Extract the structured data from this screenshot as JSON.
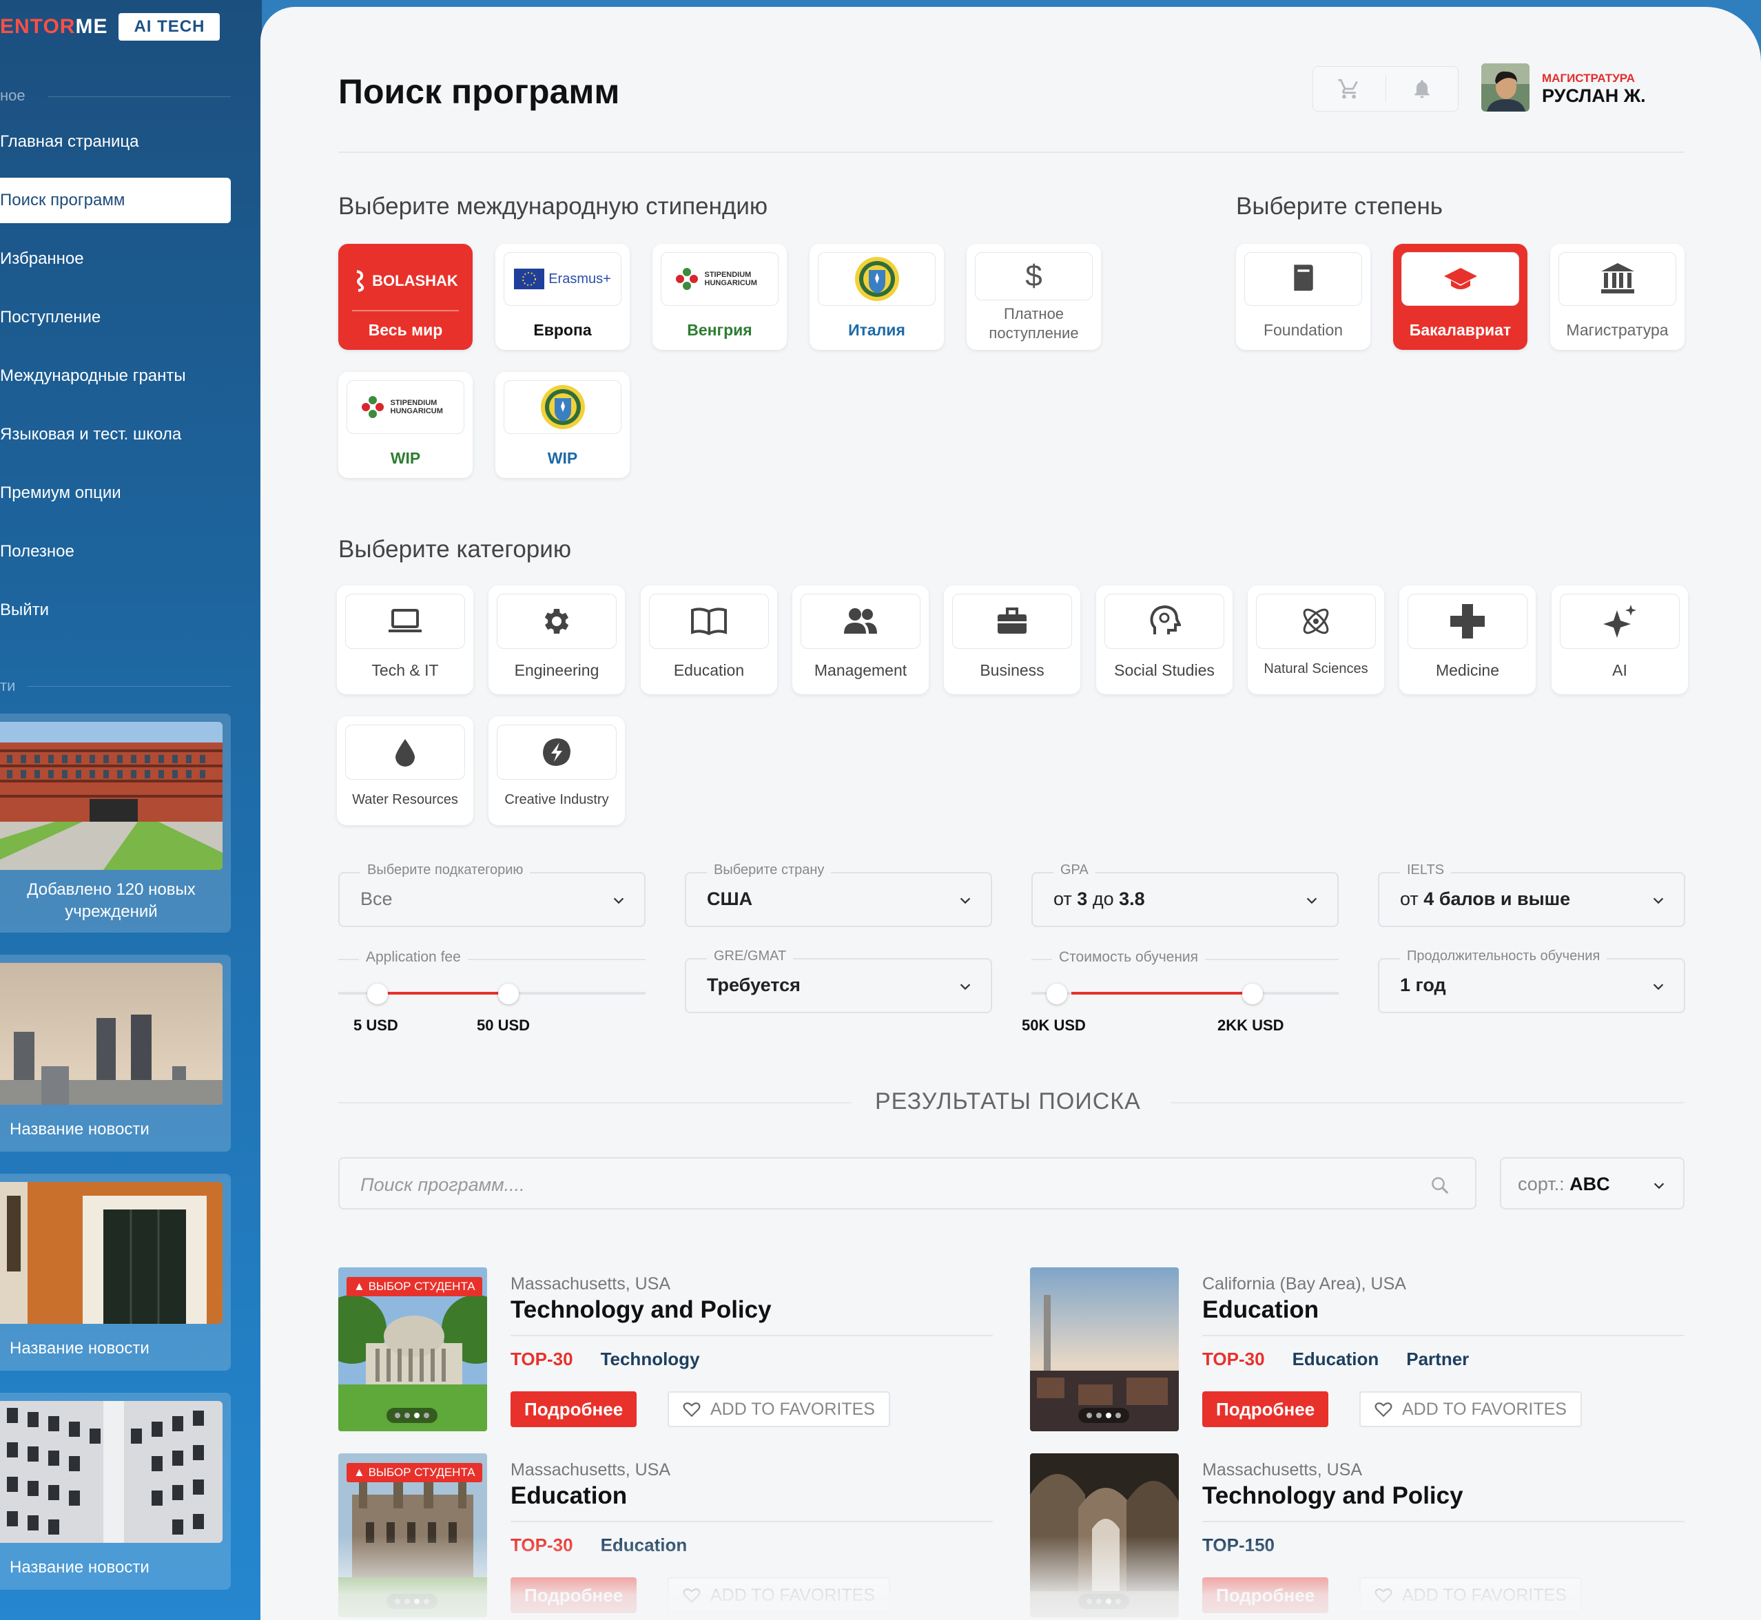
{
  "brand": {
    "logo_red": "ENTOR",
    "logo_white": "ME",
    "badge": "AI TECH",
    "accent": "#e8312b"
  },
  "sidebar": {
    "section_main": "ное",
    "items": [
      {
        "label": "Главная страница"
      },
      {
        "label": "Поиск программ"
      },
      {
        "label": "Избранное"
      },
      {
        "label": "Поступление"
      },
      {
        "label": "Международные гранты"
      },
      {
        "label": "Языковая и тест. школа"
      },
      {
        "label": "Премиум опции"
      },
      {
        "label": "Полезное"
      },
      {
        "label": "Выйти"
      }
    ],
    "section_news": "ти",
    "news": [
      {
        "caption": "Добавлено 120 новых учреждений"
      },
      {
        "caption": "Название новости"
      },
      {
        "caption": "Название новости"
      },
      {
        "caption": "Название новости"
      }
    ]
  },
  "header": {
    "title": "Поиск программ",
    "cart_icon": "cart-icon",
    "bell_icon": "bell-icon",
    "user_role": "МАГИСТРАТУРА",
    "user_name": "РУСЛАН Ж."
  },
  "scholarship": {
    "title": "Выберите международную стипендию",
    "items": [
      {
        "logo": "BOLASHAK",
        "label": "Весь мир",
        "selected": true
      },
      {
        "logo": "Erasmus+",
        "label": "Европа"
      },
      {
        "logo": "STIPENDIUM HUNGARICUM",
        "label": "Венгрия"
      },
      {
        "logo": "emblem",
        "label": "Италия"
      },
      {
        "logo": "$",
        "label": "Платное поступление"
      },
      {
        "logo": "STIPENDIUM HUNGARICUM",
        "label": "WIP"
      },
      {
        "logo": "emblem",
        "label": "WIP"
      }
    ]
  },
  "degree": {
    "title": "Выберите степень",
    "items": [
      {
        "label": "Foundation",
        "icon": "book-icon"
      },
      {
        "label": "Бакалавриат",
        "icon": "graduation-cap-icon",
        "selected": true
      },
      {
        "label": "Магистратура",
        "icon": "institution-icon"
      }
    ]
  },
  "category": {
    "title": "Выберите категорию",
    "items": [
      {
        "label": "Tech & IT",
        "icon": "laptop-icon"
      },
      {
        "label": "Engineering",
        "icon": "gear-icon"
      },
      {
        "label": "Education",
        "icon": "book-open-icon"
      },
      {
        "label": "Management",
        "icon": "users-icon"
      },
      {
        "label": "Business",
        "icon": "briefcase-icon"
      },
      {
        "label": "Social Studies",
        "icon": "head-icon"
      },
      {
        "label": "Natural Sciences",
        "icon": "atom-icon"
      },
      {
        "label": "Medicine",
        "icon": "cross-icon"
      },
      {
        "label": "AI",
        "icon": "sparkle-icon"
      },
      {
        "label": "Water Resources",
        "icon": "drop-icon"
      },
      {
        "label": "Creative Industry",
        "icon": "creative-icon"
      }
    ]
  },
  "filters": {
    "subcategory": {
      "legend": "Выберите подкатегорию",
      "value": "Все"
    },
    "country": {
      "legend": "Выберите страну",
      "value": "США"
    },
    "gpa": {
      "legend": "GPA",
      "value_from": "от ",
      "value_a": "3",
      "value_mid": " до ",
      "value_b": "3.8"
    },
    "ielts": {
      "legend": "IELTS",
      "value_from": "от ",
      "value_bold": "4 балов и выше"
    },
    "app_fee": {
      "legend": "Application fee",
      "min_label": "5 USD",
      "max_label": "50 USD",
      "min_value": 5,
      "max_value": 50
    },
    "gre": {
      "legend": "GRE/GMAT",
      "value": "Требуется"
    },
    "tuition": {
      "legend": "Стоимость обучения",
      "min_label": "50K USD",
      "max_label": "2KK USD"
    },
    "duration": {
      "legend": "Продолжительность обучения",
      "value": "1 год"
    }
  },
  "results": {
    "title": "РЕЗУЛЬТАТЫ ПОИСКА",
    "search_placeholder": "Поиск программ....",
    "sort_label": "сорт.: ",
    "sort_value": "ABC",
    "more_label": "Подробнее",
    "fav_label": "ADD TO FAVORITES",
    "badge_label": "ВЫБОР СТУДЕНТА",
    "items": [
      {
        "location": "Massachusetts, USA",
        "title": "Technology and Policy",
        "rank": "TOP-30",
        "tags": [
          "Technology"
        ],
        "badge": true
      },
      {
        "location": "California (Bay Area), USA",
        "title": "Education",
        "rank": "TOP-30",
        "tags": [
          "Education",
          "Partner"
        ],
        "badge": false
      },
      {
        "location": "Massachusetts, USA",
        "title": "Education",
        "rank": "TOP-30",
        "tags": [
          "Education"
        ],
        "badge": true
      },
      {
        "location": "Massachusetts, USA",
        "title": "Technology and Policy",
        "rank": "TOP-150",
        "tags": [],
        "badge": false
      }
    ]
  }
}
